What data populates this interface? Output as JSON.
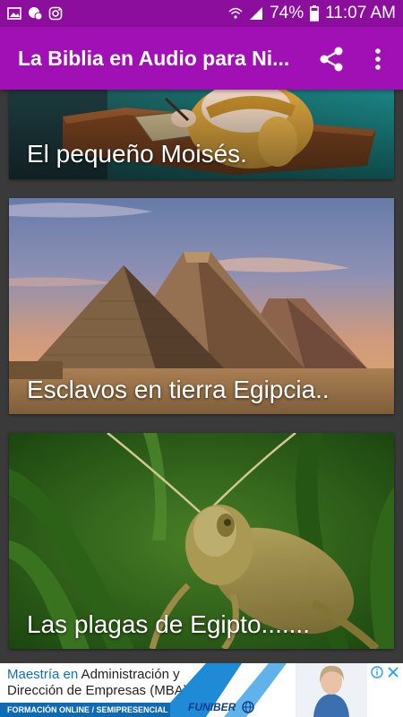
{
  "status_bar": {
    "battery": "74%",
    "time": "11:07 AM",
    "left_icons": [
      "image-icon",
      "chat-icon",
      "instagram-icon"
    ],
    "right_icons": [
      "wifi-icon",
      "signal-icon",
      "battery-icon"
    ]
  },
  "app_bar": {
    "title": "La Biblia en Audio para Ni...",
    "share_icon": "share-icon",
    "menu_icon": "more-vert-icon",
    "color": "#a010b4"
  },
  "cards": [
    {
      "title": "El pequeño Moisés."
    },
    {
      "title": "Esclavos en tierra Egipcia.."
    },
    {
      "title": "Las plagas de Egipto......."
    }
  ],
  "ad": {
    "line1_highlight": "Maestría en",
    "line1_rest": " Administración y",
    "line2": "Dirección de Empresas (MBA)",
    "footer": "FORMACIÓN ONLINE / SEMIPRESENCIAL",
    "brand": "FUNIBER",
    "close_icon": "close-icon",
    "info_icon": "info-icon"
  }
}
